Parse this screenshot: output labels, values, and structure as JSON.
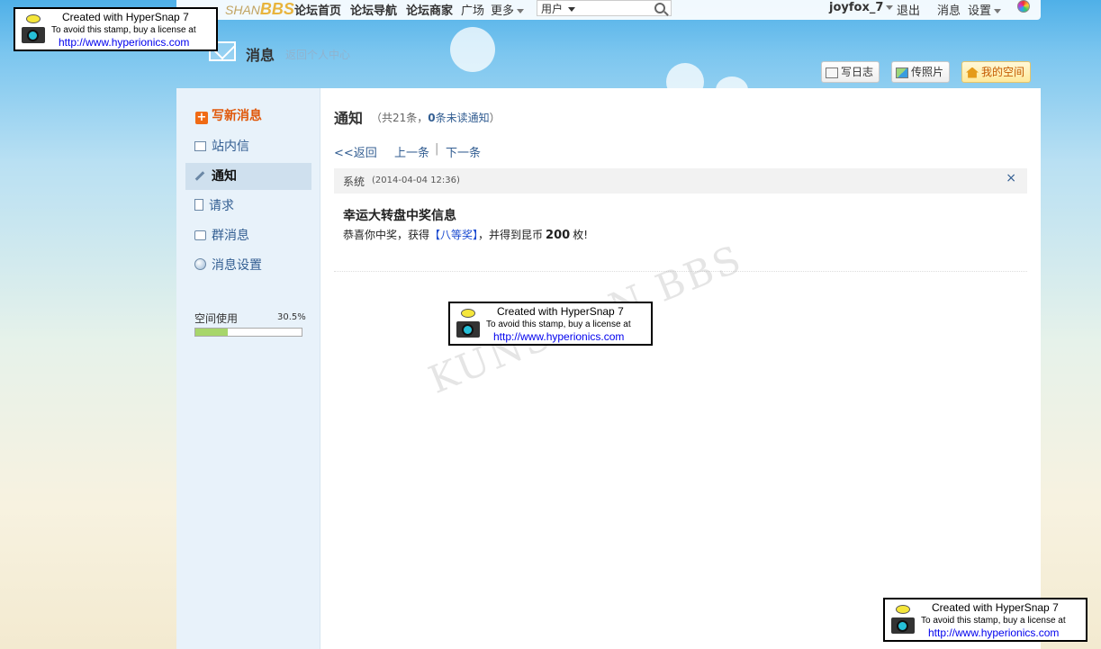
{
  "topnav": {
    "logo_prefix": "SHAN",
    "logo_brand": "BBS",
    "links": [
      "论坛首页",
      "论坛导航",
      "论坛商家"
    ],
    "square": "广场",
    "more": "更多",
    "search_scope": "用户",
    "username": "joyfox_7",
    "logout": "退出",
    "messages": "消息",
    "settings": "设置"
  },
  "header": {
    "title": "消息",
    "back_link": "返回个人中心",
    "buttons": {
      "write_blog": "写日志",
      "upload_photo": "传照片",
      "my_space": "我的空间"
    }
  },
  "sidebar": {
    "compose": "写新消息",
    "items": [
      {
        "label": "站内信",
        "icon": "mail-icon"
      },
      {
        "label": "通知",
        "icon": "pencil-icon",
        "active": true
      },
      {
        "label": "请求",
        "icon": "document-icon"
      },
      {
        "label": "群消息",
        "icon": "chat-icon"
      },
      {
        "label": "消息设置",
        "icon": "globe-icon"
      }
    ],
    "usage": {
      "label": "空间使用",
      "percent_text": "30.5%",
      "percent": 30.5
    }
  },
  "main": {
    "title": "通知",
    "count_prefix": "（共21条，",
    "unread_num": "0",
    "unread_link": "条未读通知",
    "count_suffix": "）",
    "nav_back": "<<返回",
    "nav_prev": "上一条",
    "nav_sep": "|",
    "nav_next": "下一条",
    "message": {
      "from": "系统",
      "time": "(2014-04-04 12:36)",
      "close": "×",
      "subject": "幸运大转盘中奖信息",
      "body_prefix": "恭喜你中奖，获得",
      "prize": "【八等奖】",
      "body_middle": "，并得到昆币",
      "amount": "200",
      "body_suffix": "枚!"
    }
  },
  "watermark": "KUNSHAN BBS",
  "stamp": {
    "line1": "Created with HyperSnap 7",
    "line2": "To avoid this stamp, buy a license at",
    "line3": "http://www.hyperionics.com"
  },
  "colors": {
    "accent_orange": "#e0580a",
    "link_blue": "#335e92",
    "prize_blue": "#1a4ad0",
    "usage_fill": "#a7d66a"
  }
}
